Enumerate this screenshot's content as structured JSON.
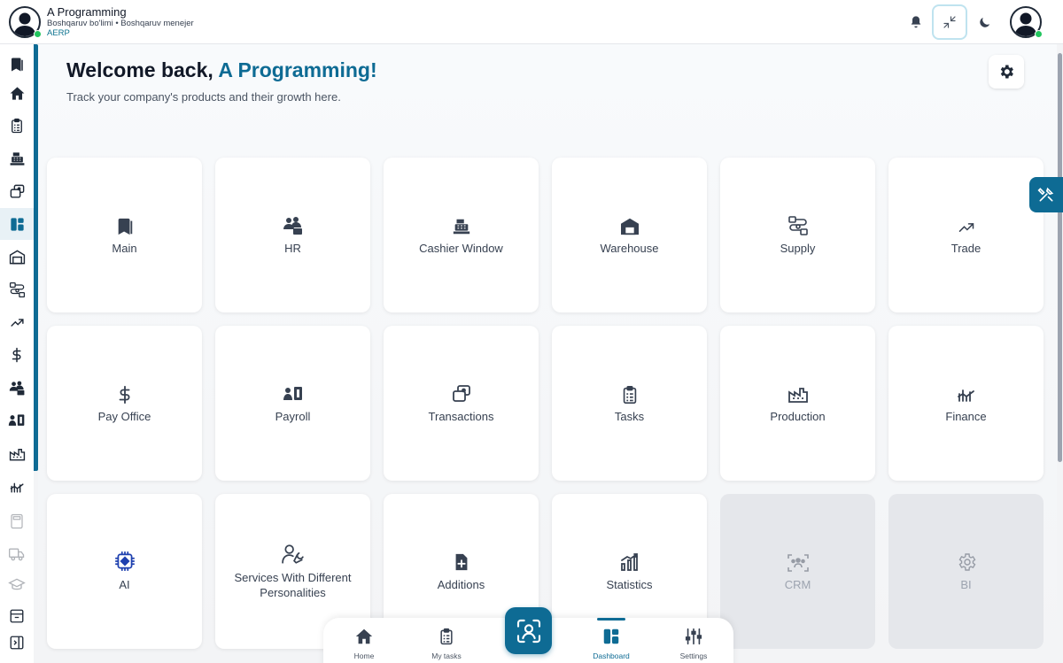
{
  "header": {
    "user_name": "A Programming",
    "user_role": "Boshqaruv bo'limi • Boshqaruv menejer",
    "user_org": "AERP"
  },
  "welcome": {
    "prefix": "Welcome back, ",
    "name": "A Programming!",
    "subtitle": "Track your company's products and their growth here."
  },
  "modules": [
    {
      "label": "Main",
      "icon": "bookmark-icon",
      "disabled": false
    },
    {
      "label": "HR",
      "icon": "people-icon",
      "disabled": false
    },
    {
      "label": "Cashier Window",
      "icon": "cash-register-icon",
      "disabled": false
    },
    {
      "label": "Warehouse",
      "icon": "warehouse-icon",
      "disabled": false
    },
    {
      "label": "Supply",
      "icon": "supply-chain-icon",
      "disabled": false
    },
    {
      "label": "Trade",
      "icon": "trend-up-icon",
      "disabled": false
    },
    {
      "label": "Pay Office",
      "icon": "dollar-icon",
      "disabled": false
    },
    {
      "label": "Payroll",
      "icon": "payroll-icon",
      "disabled": false
    },
    {
      "label": "Transactions",
      "icon": "transactions-icon",
      "disabled": false
    },
    {
      "label": "Tasks",
      "icon": "clipboard-icon",
      "disabled": false
    },
    {
      "label": "Production",
      "icon": "factory-icon",
      "disabled": false
    },
    {
      "label": "Finance",
      "icon": "finance-chart-icon",
      "disabled": false
    },
    {
      "label": "AI",
      "icon": "chip-icon",
      "disabled": false
    },
    {
      "label": "Services With Different Personalities",
      "icon": "person-wrench-icon",
      "disabled": false
    },
    {
      "label": "Additions",
      "icon": "file-plus-icon",
      "disabled": false
    },
    {
      "label": "Statistics",
      "icon": "bar-chart-icon",
      "disabled": false
    },
    {
      "label": "CRM",
      "icon": "crm-icon",
      "disabled": true
    },
    {
      "label": "BI",
      "icon": "gear-outline-icon",
      "disabled": true
    }
  ],
  "bottom_nav": [
    {
      "label": "Home",
      "icon": "home-icon"
    },
    {
      "label": "My tasks",
      "icon": "clipboard-icon"
    },
    {
      "label": "Dashboard",
      "icon": "dashboard-icon",
      "active": true
    },
    {
      "label": "Settings",
      "icon": "sliders-icon"
    }
  ],
  "colors": {
    "primary": "#0e6b94",
    "online": "#22c55e",
    "disabled_card": "#e5e7eb"
  }
}
